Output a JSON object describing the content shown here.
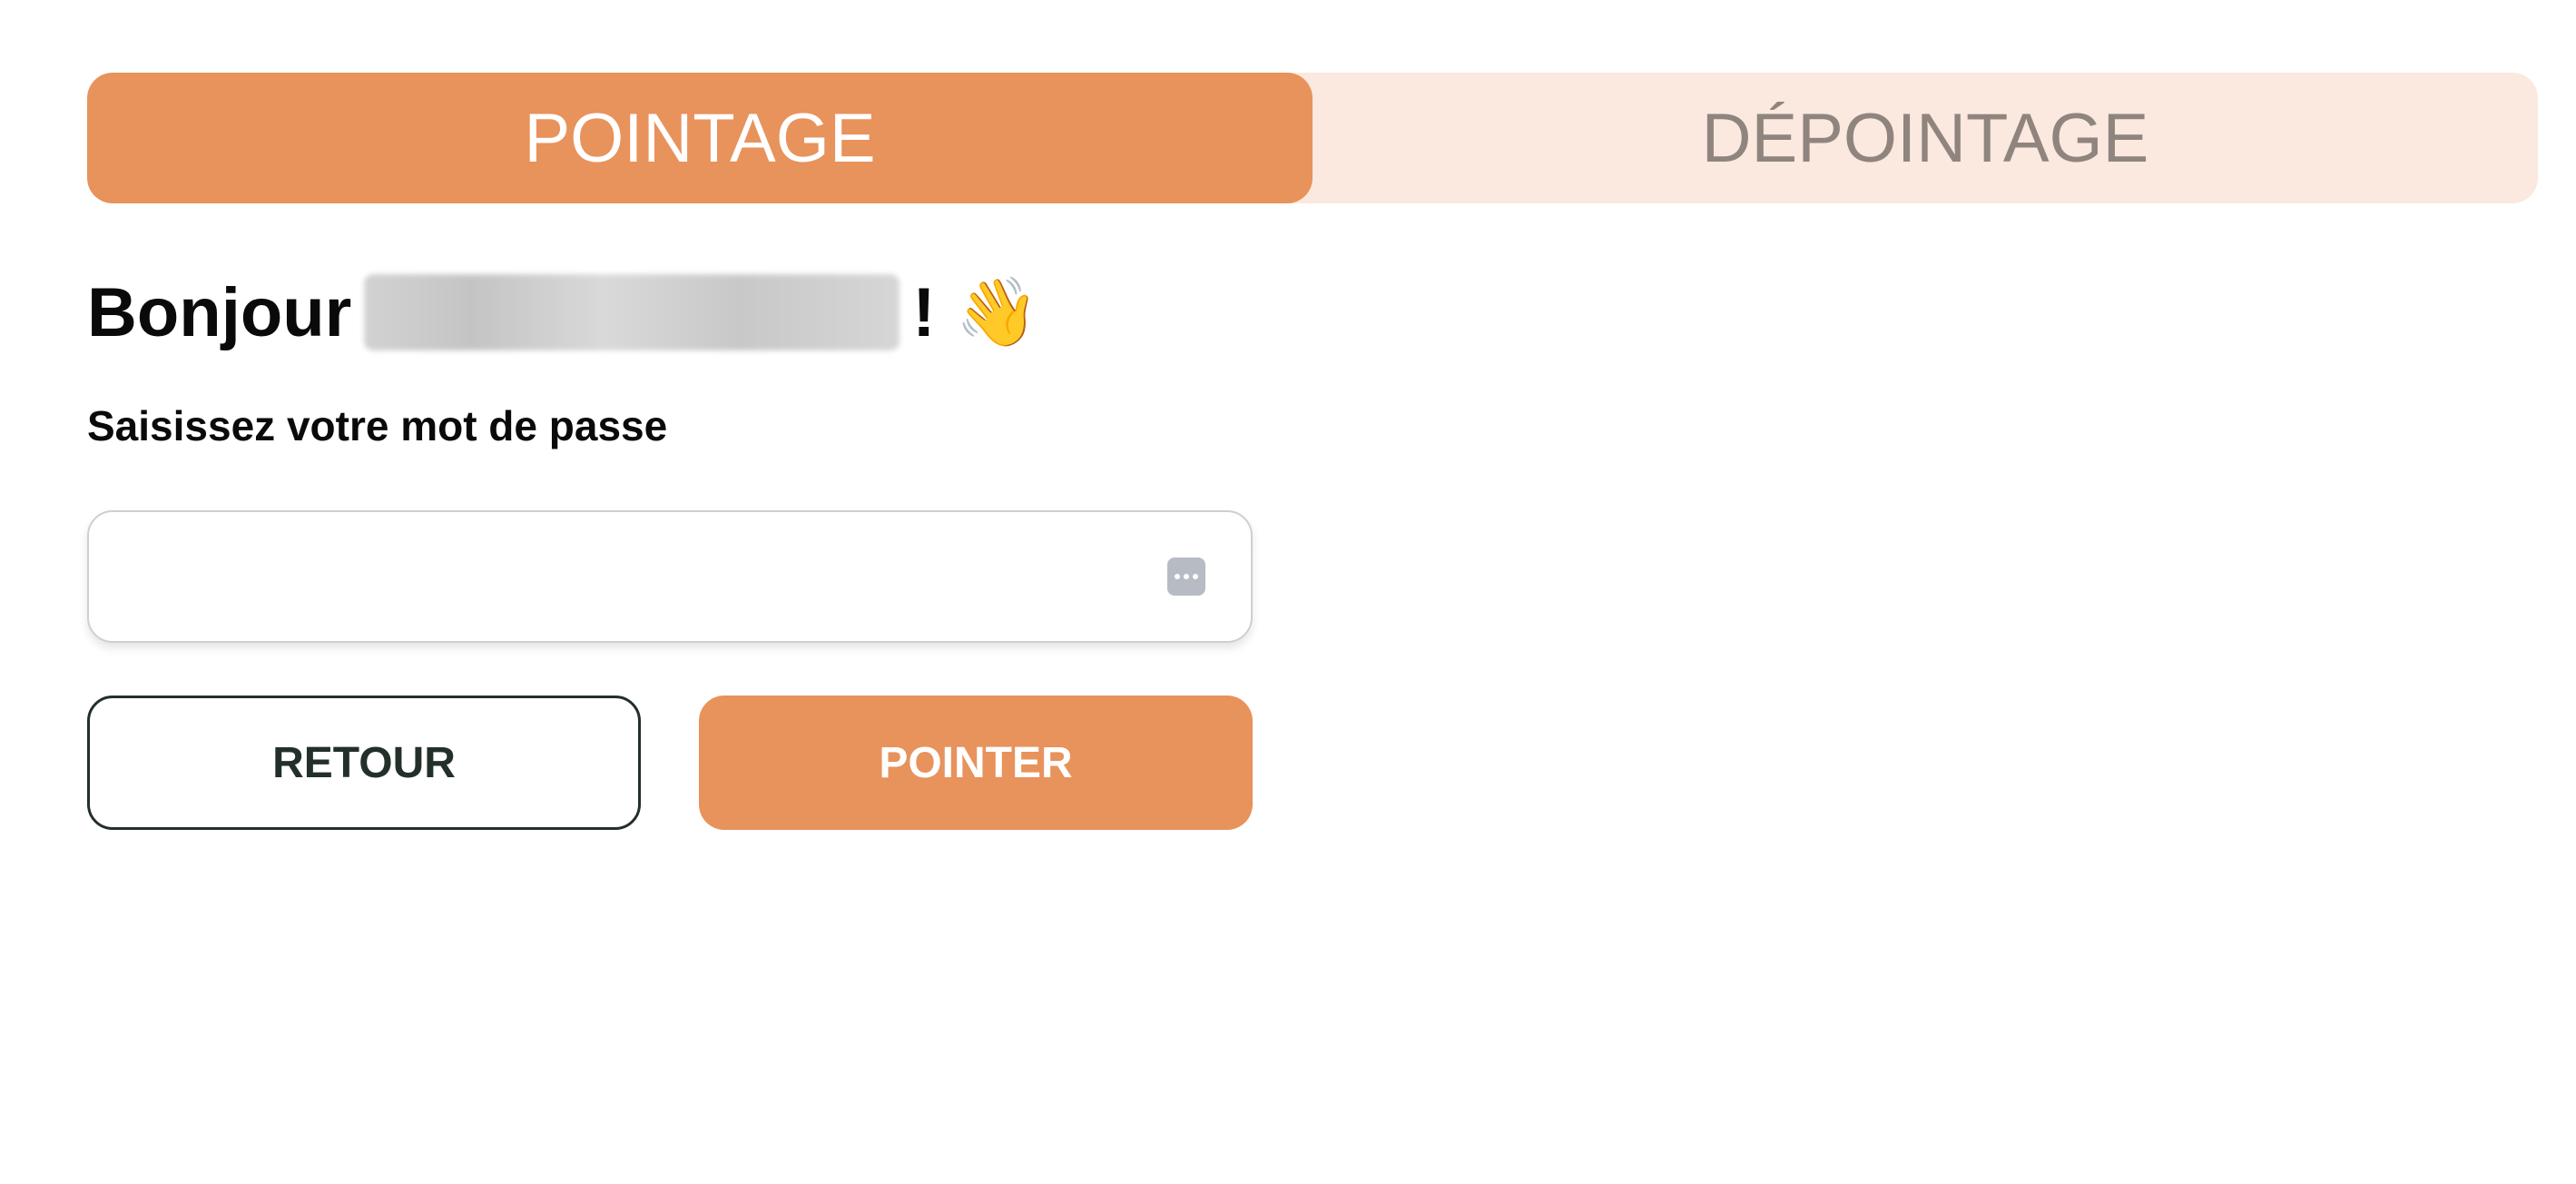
{
  "tabs": [
    {
      "label": "POINTAGE",
      "active": true
    },
    {
      "label": "DÉPOINTAGE",
      "active": false
    }
  ],
  "greeting": {
    "prefix": "Bonjour",
    "suffix": "!",
    "emoji": "👋"
  },
  "form": {
    "password_label": "Saisissez votre mot de passe",
    "password_value": "",
    "password_placeholder": "",
    "password_manager_icon": "key-dots-icon"
  },
  "buttons": {
    "back_label": "RETOUR",
    "submit_label": "POINTER"
  },
  "colors": {
    "accent": "#e8925c",
    "accent_light": "#fbe8de",
    "inactive_text": "#8f857e",
    "dark_text": "#23302a"
  }
}
